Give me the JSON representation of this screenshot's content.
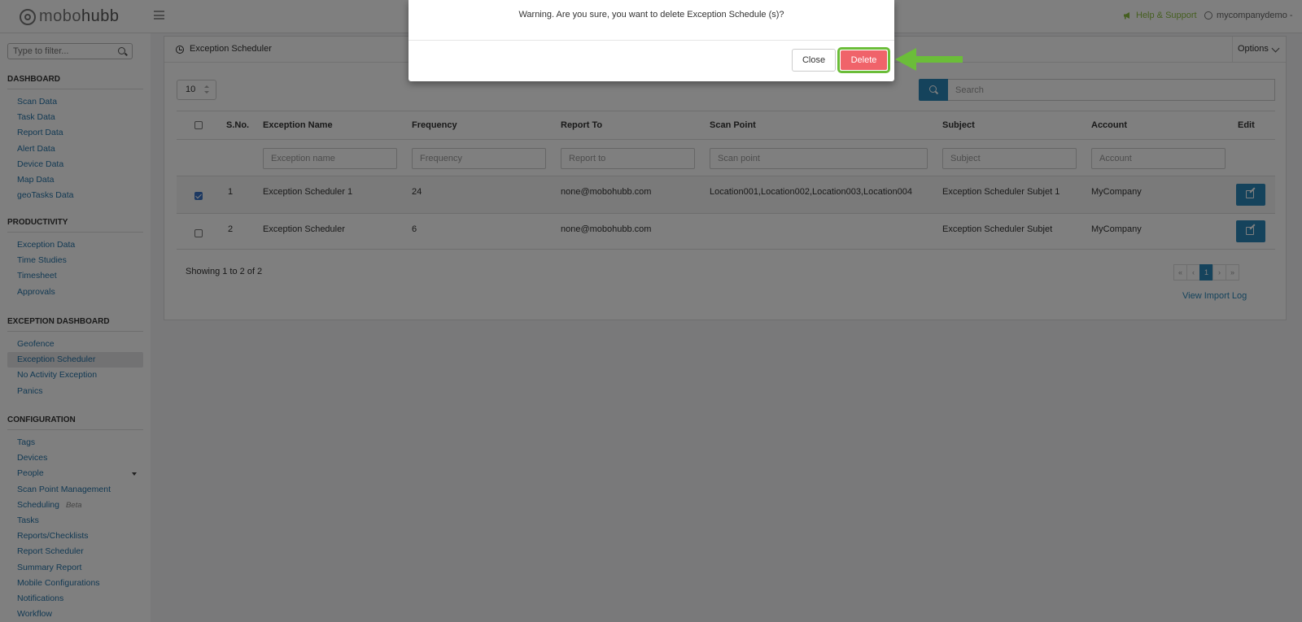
{
  "topbar": {
    "logo_part1": "mobo",
    "logo_part2": "hubb",
    "help_label": "Help & Support",
    "user_label": "mycompanydemo -"
  },
  "sidebar": {
    "filter_placeholder": "Type to filter...",
    "sections": {
      "dashboard": {
        "title": "DASHBOARD",
        "items": [
          "Scan Data",
          "Task Data",
          "Report Data",
          "Alert Data",
          "Device Data",
          "Map Data",
          "geoTasks Data"
        ]
      },
      "productivity": {
        "title": "PRODUCTIVITY",
        "items": [
          "Exception Data",
          "Time Studies",
          "Timesheet",
          "Approvals"
        ]
      },
      "exception": {
        "title": "EXCEPTION DASHBOARD",
        "items": [
          "Geofence",
          "Exception Scheduler",
          "No Activity Exception",
          "Panics"
        ],
        "active": "Exception Scheduler"
      },
      "configuration": {
        "title": "CONFIGURATION",
        "items": [
          "Tags",
          "Devices",
          "People",
          "Scan Point Management",
          "Scheduling",
          "Tasks",
          "Reports/Checklists",
          "Report Scheduler",
          "Summary Report",
          "Mobile Configurations",
          "Notifications",
          "Workflow"
        ],
        "beta_label": "Beta"
      }
    }
  },
  "panel": {
    "title": "Exception Scheduler",
    "options_label": "Options",
    "page_size": "10",
    "search_placeholder": "Search",
    "columns": [
      "S.No.",
      "Exception Name",
      "Frequency",
      "Report To",
      "Scan Point",
      "Subject",
      "Account",
      "Edit"
    ],
    "filters": {
      "exception_name": "Exception name",
      "frequency": "Frequency",
      "report_to": "Report to",
      "scan_point": "Scan point",
      "subject": "Subject",
      "account": "Account"
    },
    "rows": [
      {
        "sno": "1",
        "name": "Exception Scheduler 1",
        "frequency": "24",
        "report_to": "none@mobohubb.com",
        "scan_point": "Location001,Location002,Location003,Location004",
        "subject": "Exception Scheduler Subjet 1",
        "account": "MyCompany",
        "checked": true
      },
      {
        "sno": "2",
        "name": "Exception Scheduler",
        "frequency": "6",
        "report_to": "none@mobohubb.com",
        "scan_point": "",
        "subject": "Exception Scheduler Subjet",
        "account": "MyCompany",
        "checked": false
      }
    ],
    "showing": "Showing 1 to 2 of 2",
    "pager": {
      "first": "«",
      "prev": "‹",
      "current": "1",
      "next": "›",
      "last": "»"
    },
    "import_log": "View Import Log"
  },
  "modal": {
    "message": "Warning. Are you sure, you want to delete Exception Schedule (s)?",
    "close_label": "Close",
    "delete_label": "Delete"
  },
  "colors": {
    "primary_blue": "#2a86b8",
    "link_blue": "#2573a7",
    "help_green": "#8dbf42",
    "delete_red": "#f0636a",
    "highlight_green": "#6bbd39"
  }
}
